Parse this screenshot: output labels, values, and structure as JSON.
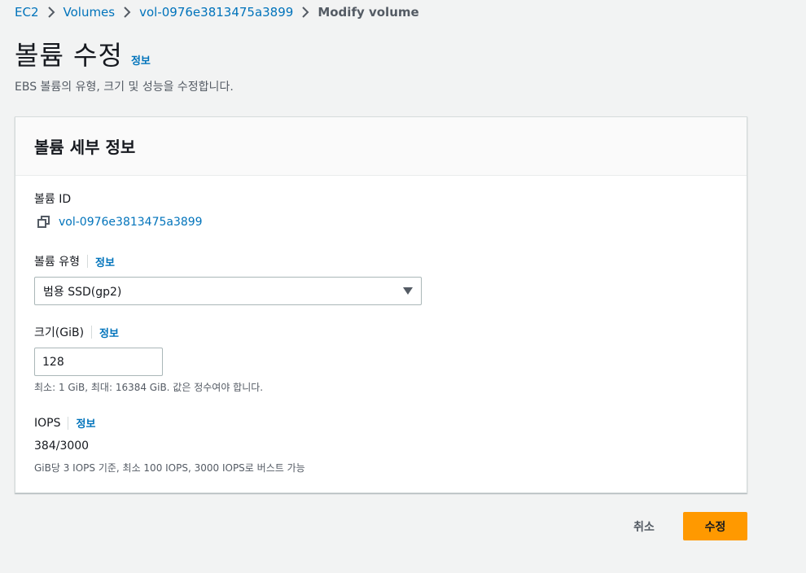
{
  "breadcrumb": {
    "items": [
      "EC2",
      "Volumes",
      "vol-0976e3813475a3899"
    ],
    "current": "Modify volume"
  },
  "header": {
    "title": "볼륨 수정",
    "info": "정보",
    "description": "EBS 볼륨의 유형, 크기 및 성능을 수정합니다."
  },
  "panel": {
    "title": "볼륨 세부 정보",
    "volume_id": {
      "label": "볼륨 ID",
      "value": "vol-0976e3813475a3899"
    },
    "volume_type": {
      "label": "볼륨 유형",
      "info": "정보",
      "selected": "범용 SSD(gp2)"
    },
    "size": {
      "label": "크기(GiB)",
      "info": "정보",
      "value": "128",
      "hint": "최소: 1 GiB, 최대: 16384 GiB. 값은 정수여야 합니다."
    },
    "iops": {
      "label": "IOPS",
      "info": "정보",
      "value": "384/3000",
      "hint": "GiB당 3 IOPS 기준, 최소 100 IOPS, 3000 IOPS로 버스트 가능"
    }
  },
  "footer": {
    "cancel_label": "취소",
    "submit_label": "수정"
  },
  "colors": {
    "link": "#0073bb",
    "primary_button": "#ff9900",
    "background": "#f2f3f3"
  },
  "icons": {
    "breadcrumb_separator": "chevron-right-icon",
    "copy": "copy-icon",
    "select_caret": "caret-down-icon"
  }
}
